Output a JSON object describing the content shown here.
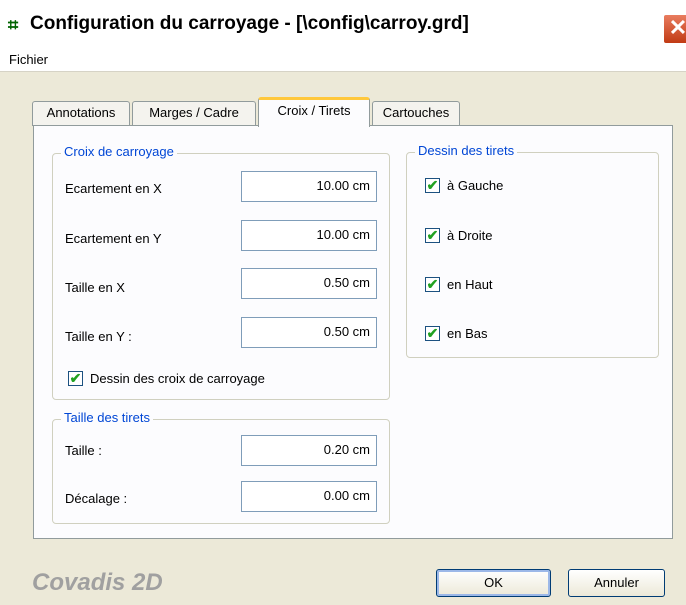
{
  "window": {
    "title": "Configuration  du carroyage - [\\config\\carroy.grd]",
    "icon": "grid-app-icon",
    "close_glyph": "✕"
  },
  "menu": {
    "items": [
      "Fichier"
    ]
  },
  "tabs": [
    {
      "label": "Annotations",
      "active": false
    },
    {
      "label": "Marges / Cadre",
      "active": false
    },
    {
      "label": "Croix / Tirets",
      "active": true
    },
    {
      "label": "Cartouches",
      "active": false
    }
  ],
  "croix_group": {
    "title": "Croix de carroyage",
    "fields": [
      {
        "label": "Ecartement en X",
        "value": "10.00 cm"
      },
      {
        "label": "Ecartement en Y",
        "value": "10.00 cm"
      },
      {
        "label": "Taille en X",
        "value": "0.50 cm"
      },
      {
        "label": "Taille en Y :",
        "value": "0.50 cm"
      }
    ],
    "checkbox": {
      "label": "Dessin des croix de carroyage",
      "checked": true
    }
  },
  "tirets_group": {
    "title": "Taille des tirets",
    "fields": [
      {
        "label": "Taille :",
        "value": "0.20 cm"
      },
      {
        "label": "Décalage :",
        "value": "0.00 cm"
      }
    ]
  },
  "dessin_group": {
    "title": "Dessin des tirets",
    "options": [
      {
        "label": "à Gauche",
        "checked": true
      },
      {
        "label": "à Droite",
        "checked": true
      },
      {
        "label": "en Haut",
        "checked": true
      },
      {
        "label": "en Bas",
        "checked": true
      }
    ]
  },
  "footer": {
    "brand": "Covadis 2D",
    "ok_label": "OK",
    "cancel_label": "Annuler"
  },
  "check_glyph": "✔"
}
